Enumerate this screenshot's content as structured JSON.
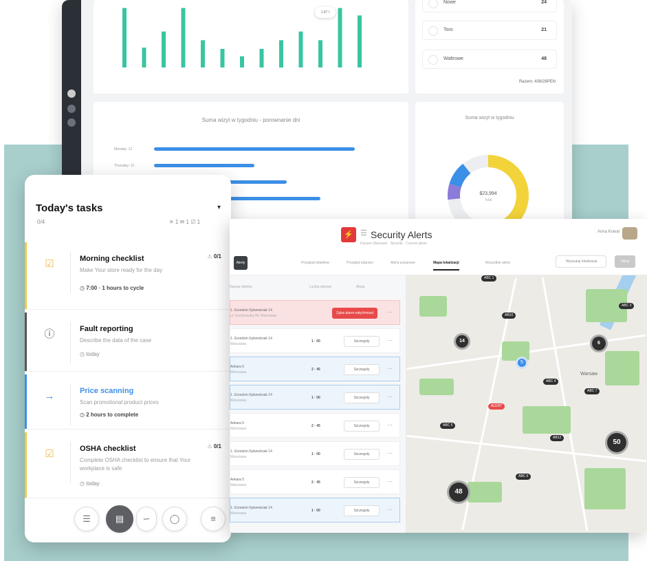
{
  "dashboard": {
    "bar_chart": {
      "values": [
        96,
        32,
        58,
        96,
        44,
        30,
        18,
        30,
        44,
        58,
        44,
        96,
        84
      ],
      "tooltip": "1,87 t",
      "color": "#39c5a2"
    },
    "legend": [
      {
        "name": "Nowe",
        "value": "24"
      },
      {
        "name": "Toro",
        "value": "21"
      },
      {
        "name": "Waltrowe",
        "value": "48"
      }
    ],
    "legend_footer": "Razem: 408/28PEN",
    "hbar_title": "Suma wizyt w tygodniu - porownanie dni",
    "hbar_labels": [
      "Monday: 12",
      "Thursday: 12"
    ],
    "hbar_values": [
      100,
      50,
      66,
      83
    ],
    "donut_title": "Suma wizyt w tygodniu",
    "donut_value": "$23,994",
    "donut_caption": "Total",
    "donut_colors": [
      "#f3d33a",
      "#3c8fe6",
      "#8c7bd8"
    ]
  },
  "tasks": {
    "title": "Today's tasks",
    "count": "0/4",
    "stats": "✕ 1  ✉ 1  ☑ 1",
    "items": [
      {
        "name": "Morning checklist",
        "desc": "Make Your store ready for the day",
        "meta": "7:00  · 1 hours to cycle",
        "progress": "0/1",
        "color": "#f2c94c",
        "icon": "☑",
        "icon_color": "#f2b84c"
      },
      {
        "name": "Fault reporting",
        "desc": "Describe the data of the case",
        "meta": "today",
        "progress": "",
        "color": "#555555",
        "icon": "ⓘ",
        "icon_color": "#555555"
      },
      {
        "name": "Price scanning",
        "desc": "Scan promotional product prices",
        "meta": "2 hours to complete",
        "progress": "",
        "color": "#3c8fe6",
        "icon": "→",
        "icon_color": "#3c8fe6"
      },
      {
        "name": "OSHA checklist",
        "desc": "Complete OSHA checklist to ensure that Your workplace is safe",
        "meta": "today",
        "progress": "0/1",
        "color": "#f2c94c",
        "icon": "☑",
        "icon_color": "#f2b84c"
      }
    ]
  },
  "security": {
    "title": "Security Alerts",
    "breadcrumb": "Kanzex (Warsaw) · Security · Current alerts",
    "user": "Anna Kowal",
    "tabs": [
      "Przeglad obiektow",
      "Przeglad zdarzen",
      "Alerty pozarowe",
      "Mapa lokalizacji",
      "Wszystkie alerty"
    ],
    "active_tab": "Mapa lokalizacji",
    "pill": "Alerty",
    "search": "Wyszukaj lokalizacje",
    "filter": "Filtruj",
    "table_headers": [
      "Nazwa obiektu",
      "Liczba alertow",
      "Akcja"
    ],
    "rows": [
      {
        "name": "1. Grzedzin-Sylwestrzak 14",
        "sub": "ul. Grzybowska 34, Warszawa",
        "num": "",
        "btn": "Zglos alarm natychmiast",
        "kind": "alert"
      },
      {
        "name": "1. Grzedzin-Sylwestrzak 14",
        "sub": "Warszawa",
        "num": "1 · 00",
        "btn": "Szczegoly",
        "kind": ""
      },
      {
        "name": "Ankara 5",
        "sub": "Warszawa",
        "num": "2 · 45",
        "btn": "Szczegoly",
        "kind": "hl"
      },
      {
        "name": "1. Grzedzin-Sylwestrzak 14",
        "sub": "Warszawa",
        "num": "1 · 00",
        "btn": "Szczegoly",
        "kind": "hl"
      },
      {
        "name": "Ankara 5",
        "sub": "Warszawa",
        "num": "2 · 45",
        "btn": "Szczegoly",
        "kind": ""
      },
      {
        "name": "1. Grzedzin-Sylwestrzak 14",
        "sub": "Warszawa",
        "num": "1 · 00",
        "btn": "Szczegoly",
        "kind": ""
      },
      {
        "name": "Ankara 5",
        "sub": "Warszawa",
        "num": "2 · 45",
        "btn": "Szczegoly",
        "kind": ""
      },
      {
        "name": "1. Grzedzin-Sylwestrzak 14",
        "sub": "Warszawa",
        "num": "1 · 00",
        "btn": "Szczegoly",
        "kind": "hl"
      }
    ],
    "map": {
      "city": "Warsaw",
      "clusters": [
        "14",
        "6",
        "50",
        "48"
      ],
      "labels": [
        "ABC 1",
        "AB10",
        "ABC 3",
        "ABC 4",
        "ABC 5",
        "AB12",
        "ABC 6",
        "ABC 7"
      ],
      "red_label": "ALERT",
      "pin": "5"
    }
  }
}
